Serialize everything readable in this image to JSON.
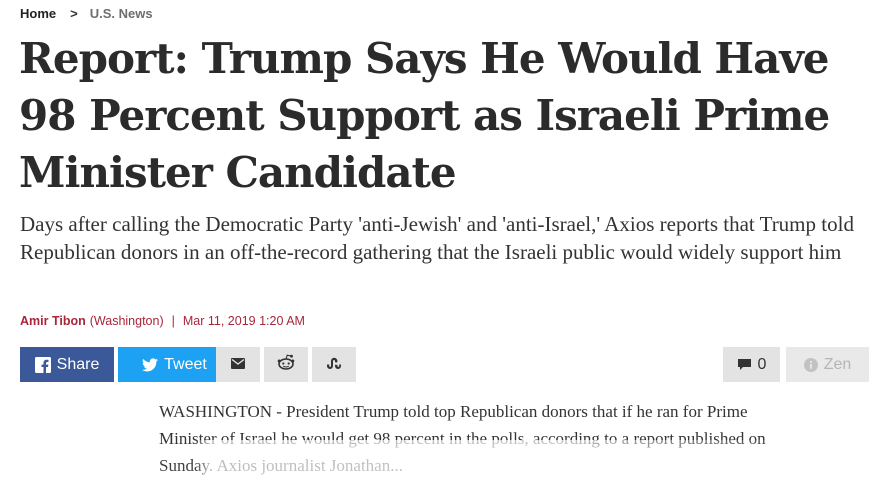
{
  "breadcrumb": {
    "home": "Home",
    "separator": ">",
    "category": "U.S. News"
  },
  "article": {
    "headline": "Report: Trump Says He Would Have 98 Percent Support as Israeli Prime Minister Candidate",
    "dek": "Days after calling the Democratic Party 'anti-Jewish' and 'anti-Israel,' Axios reports that Trump told Republican donors in an off-the-record gathering that the Israeli public would widely support him",
    "author": "Amir Tibon",
    "location": "(Washington)",
    "byline_separator": "|",
    "date": "Mar 11, 2019 1:20 AM",
    "body_text": "WASHINGTON - President Trump told top Republican donors that if he ran for Prime Minister of Israel he would get 98 percent in the polls, according to a report published on Sunday. Axios journalist Jonathan..."
  },
  "share": {
    "facebook_label": "Share",
    "twitter_label": "Tweet",
    "comments_count": "0",
    "zen_label": "Zen"
  },
  "colors": {
    "facebook": "#3b5998",
    "twitter": "#1da1f2",
    "byline": "#a8263a",
    "button_gray": "#e3e3e3"
  },
  "icons": {
    "facebook": "facebook-icon",
    "twitter": "twitter-icon",
    "mail": "mail-icon",
    "reddit": "reddit-icon",
    "stumbleupon": "stumbleupon-icon",
    "comments": "comment-icon",
    "zen": "info-icon"
  }
}
